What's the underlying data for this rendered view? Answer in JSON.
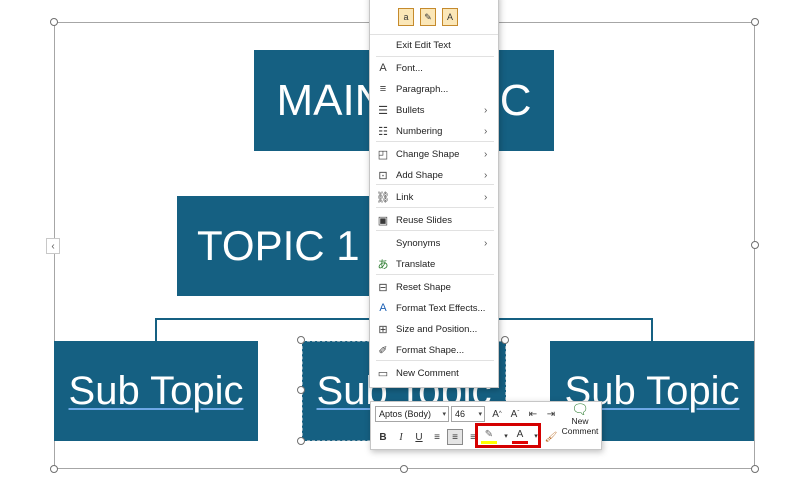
{
  "slide": {
    "main_topic": "MAIN TOPIC",
    "topic_1": "TOPIC 1",
    "sub_topics": [
      "Sub Topic",
      "Sub Topic",
      "Sub Topic"
    ],
    "shape_color": "#156082"
  },
  "context_menu": {
    "paste_options": [
      "paste-icon",
      "paste-keep-format-icon",
      "paste-text-only-icon"
    ],
    "items": [
      {
        "label": "Exit Edit Text",
        "icon": ""
      },
      {
        "label": "Font...",
        "icon": "font-icon"
      },
      {
        "label": "Paragraph...",
        "icon": "paragraph-icon"
      },
      {
        "label": "Bullets",
        "icon": "bullets-icon",
        "submenu": true
      },
      {
        "label": "Numbering",
        "icon": "numbering-icon",
        "submenu": true
      },
      {
        "label": "Change Shape",
        "icon": "change-shape-icon",
        "submenu": true
      },
      {
        "label": "Add Shape",
        "icon": "add-shape-icon",
        "submenu": true
      },
      {
        "label": "Link",
        "icon": "link-icon",
        "submenu": true
      },
      {
        "label": "Reuse Slides",
        "icon": "reuse-slides-icon"
      },
      {
        "label": "Synonyms",
        "icon": "",
        "submenu": true
      },
      {
        "label": "Translate",
        "icon": "translate-icon"
      },
      {
        "label": "Reset Shape",
        "icon": "reset-shape-icon"
      },
      {
        "label": "Format Text Effects...",
        "icon": "text-effects-icon"
      },
      {
        "label": "Size and Position...",
        "icon": "size-position-icon"
      },
      {
        "label": "Format Shape...",
        "icon": "format-shape-icon"
      },
      {
        "label": "New Comment",
        "icon": "comment-icon"
      }
    ]
  },
  "mini_toolbar": {
    "font_name": "Aptos (Body)",
    "font_size": "46",
    "new_comment_label": "New Comment",
    "highlight_color": "#ffff00",
    "font_color": "#e00000"
  }
}
